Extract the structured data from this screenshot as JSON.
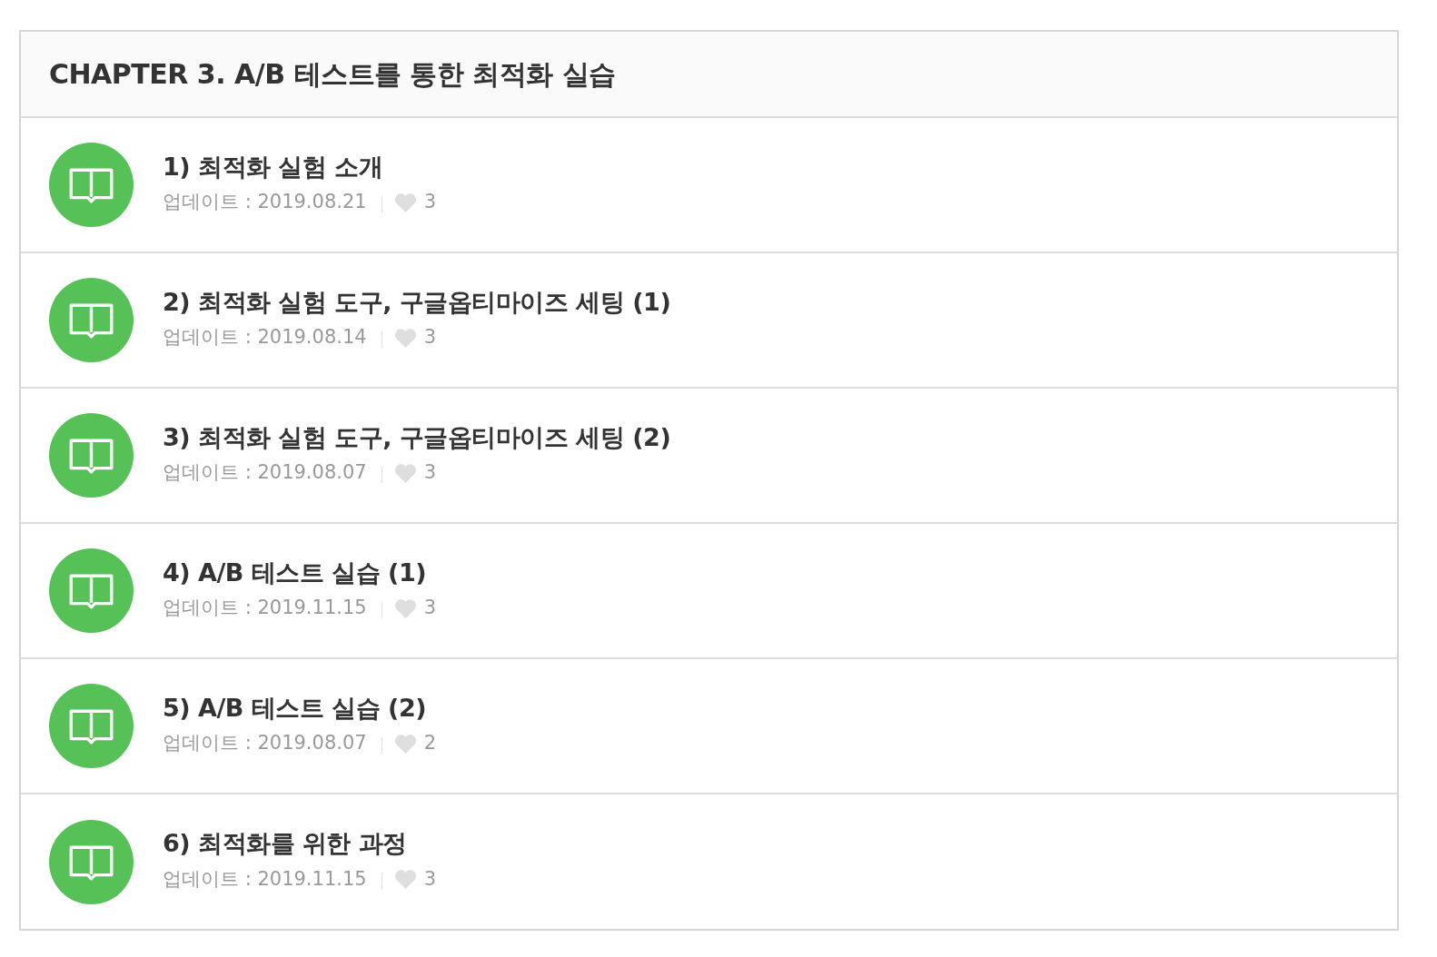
{
  "chapter": {
    "title": "CHAPTER 3. A/B 테스트를 통한 최적화 실습"
  },
  "lessons": [
    {
      "title": "1) 최적화 실험 소개",
      "updated": "업데이트 : 2019.08.21",
      "likes": "3"
    },
    {
      "title": "2) 최적화 실험 도구, 구글옵티마이즈 세팅 (1)",
      "updated": "업데이트 : 2019.08.14",
      "likes": "3"
    },
    {
      "title": "3) 최적화 실험 도구, 구글옵티마이즈 세팅 (2)",
      "updated": "업데이트 : 2019.08.07",
      "likes": "3"
    },
    {
      "title": "4) A/B 테스트 실습 (1)",
      "updated": "업데이트 : 2019.11.15",
      "likes": "3"
    },
    {
      "title": "5) A/B 테스트 실습 (2)",
      "updated": "업데이트 : 2019.08.07",
      "likes": "2"
    },
    {
      "title": "6) 최적화를 위한 과정",
      "updated": "업데이트 : 2019.11.15",
      "likes": "3"
    }
  ]
}
